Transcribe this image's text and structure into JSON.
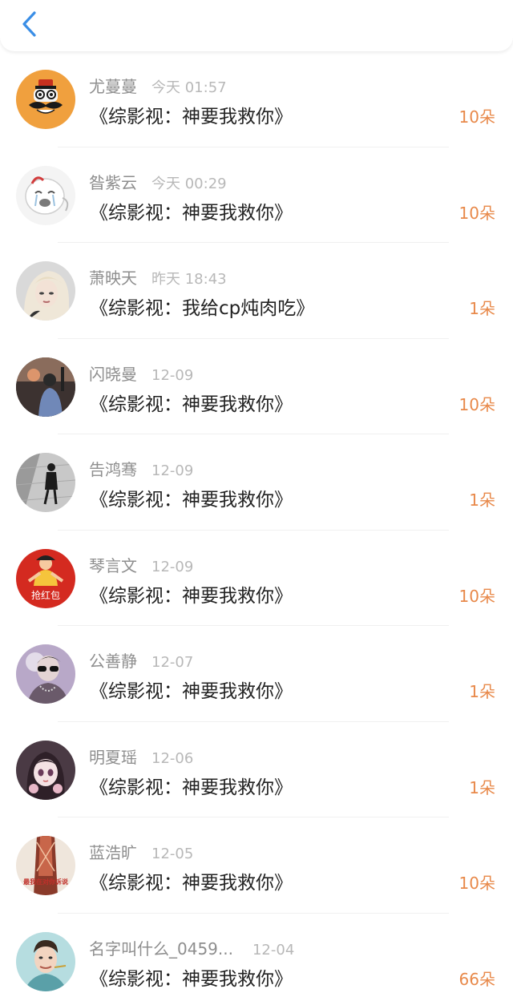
{
  "header": {
    "back_icon": "chevron-left-icon",
    "accent_color": "#3a8ee6"
  },
  "colors": {
    "count": "#e8894a",
    "name": "#8e8e8e",
    "time": "#b8b8b8",
    "title": "#222222"
  },
  "items": [
    {
      "name": "尤蔓蔓",
      "time": "今天 01:57",
      "title": "《综影视：神要我救你》",
      "count": "10朵",
      "avatar": "mustache-mascot-avatar"
    },
    {
      "name": "昝紫云",
      "time": "今天 00:29",
      "title": "《综影视：神要我救你》",
      "count": "10朵",
      "avatar": "crying-meme-avatar"
    },
    {
      "name": "萧映天",
      "time": "昨天 18:43",
      "title": "《综影视：我给cp炖肉吃》",
      "count": "1朵",
      "avatar": "blonde-woman-avatar"
    },
    {
      "name": "闪晓曼",
      "time": "12-09",
      "title": "《综影视：神要我救你》",
      "count": "10朵",
      "avatar": "sunset-person-avatar"
    },
    {
      "name": "告鸿骞",
      "time": "12-09",
      "title": "《综影视：神要我救你》",
      "count": "1朵",
      "avatar": "monochrome-person-avatar"
    },
    {
      "name": "琴言文",
      "time": "12-09",
      "title": "《综影视：神要我救你》",
      "count": "10朵",
      "avatar": "red-envelope-avatar",
      "avatar_text": "抢红包"
    },
    {
      "name": "公善静",
      "time": "12-07",
      "title": "《综影视：神要我救你》",
      "count": "1朵",
      "avatar": "sunglasses-person-avatar"
    },
    {
      "name": "明夏瑶",
      "time": "12-06",
      "title": "《综影视：神要我救你》",
      "count": "1朵",
      "avatar": "anime-girl-avatar"
    },
    {
      "name": "蓝浩旷",
      "time": "12-05",
      "title": "《综影视：神要我救你》",
      "count": "10朵",
      "avatar": "text-caption-avatar",
      "avatar_text": "最我在对你诉说"
    },
    {
      "name": "名字叫什么_0459...",
      "time": "12-04",
      "title": "《综影视：神要我救你》",
      "count": "66朵",
      "avatar": "man-portrait-avatar"
    }
  ]
}
